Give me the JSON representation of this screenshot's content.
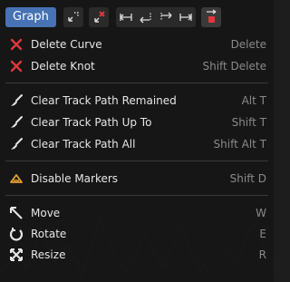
{
  "header": {
    "title": "Graph",
    "buttons": [
      "snap-icon",
      "delete-key-icon",
      "jump-start-icon",
      "jump-prev-icon",
      "jump-next-icon",
      "jump-end-icon",
      "jump-selected-icon"
    ]
  },
  "menu": {
    "items": [
      {
        "label": "Delete Curve",
        "shortcut": "Delete",
        "icon": "x-icon"
      },
      {
        "label": "Delete Knot",
        "shortcut": "Shift Delete",
        "icon": "x-icon"
      },
      {
        "label": "Clear Track Path Remained",
        "shortcut": "Alt T",
        "icon": "brush-icon"
      },
      {
        "label": "Clear Track Path Up To",
        "shortcut": "Shift T",
        "icon": "brush-icon"
      },
      {
        "label": "Clear Track Path All",
        "shortcut": "Shift Alt T",
        "icon": "brush-icon"
      },
      {
        "label": "Disable Markers",
        "shortcut": "Shift D",
        "icon": "marker-icon"
      },
      {
        "label": "Move",
        "shortcut": "W",
        "icon": "move-icon"
      },
      {
        "label": "Rotate",
        "shortcut": "E",
        "icon": "rotate-icon"
      },
      {
        "label": "Resize",
        "shortcut": "R",
        "icon": "resize-icon"
      }
    ]
  },
  "colors": {
    "accent": "#4772b3",
    "danger": "#e0363d",
    "marker": "#e8a030"
  }
}
